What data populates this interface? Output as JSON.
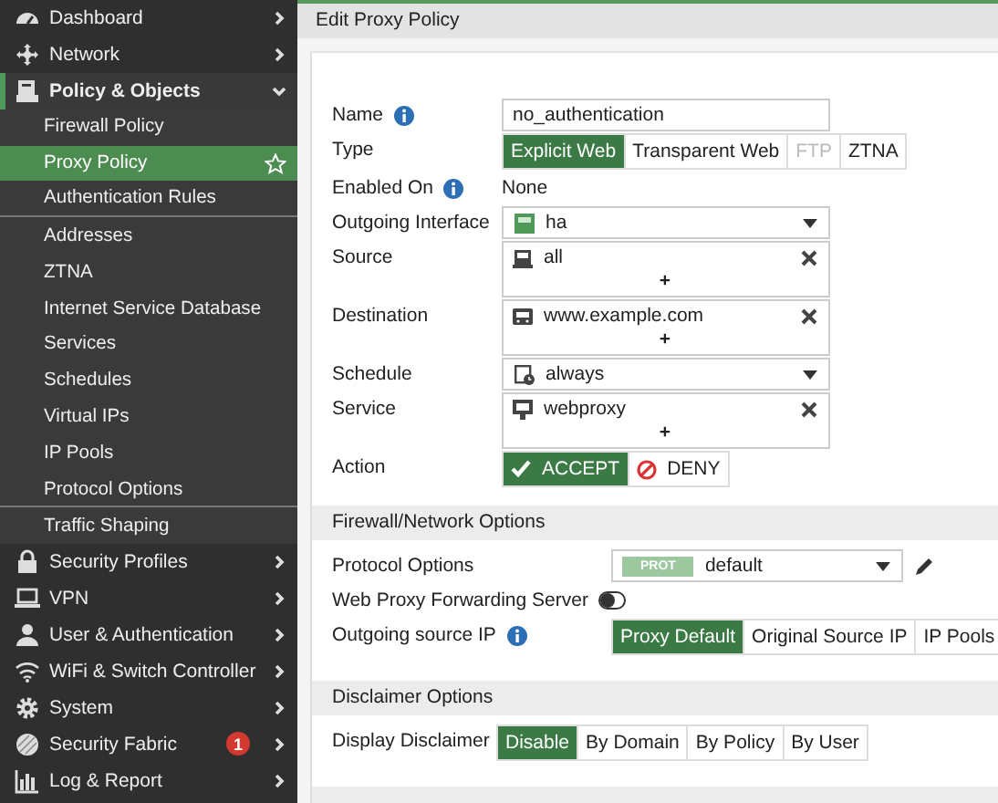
{
  "sidebar": {
    "items": [
      {
        "kind": "top",
        "label": "Dashboard",
        "expanded": false,
        "selected": false
      },
      {
        "kind": "top",
        "label": "Network",
        "expanded": false,
        "selected": false
      },
      {
        "kind": "top",
        "label": "Policy & Objects",
        "expanded": true,
        "selected": false
      },
      {
        "kind": "sub",
        "label": "Firewall Policy",
        "selected": false,
        "separator": false
      },
      {
        "kind": "sub",
        "label": "Proxy Policy",
        "selected": true,
        "separator": false,
        "favorite": true
      },
      {
        "kind": "sub",
        "label": "Authentication Rules",
        "selected": false,
        "separator": true
      },
      {
        "kind": "sub",
        "label": "Addresses",
        "selected": false,
        "separator": false
      },
      {
        "kind": "sub",
        "label": "ZTNA",
        "selected": false,
        "separator": false
      },
      {
        "kind": "sub",
        "label": "Internet Service Database",
        "selected": false,
        "separator": false
      },
      {
        "kind": "sub",
        "label": "Services",
        "selected": false,
        "separator": false
      },
      {
        "kind": "sub",
        "label": "Schedules",
        "selected": false,
        "separator": false
      },
      {
        "kind": "sub",
        "label": "Virtual IPs",
        "selected": false,
        "separator": false
      },
      {
        "kind": "sub",
        "label": "IP Pools",
        "selected": false,
        "separator": false
      },
      {
        "kind": "sub",
        "label": "Protocol Options",
        "selected": false,
        "separator": true
      },
      {
        "kind": "sub",
        "label": "Traffic Shaping",
        "selected": false,
        "separator": false
      },
      {
        "kind": "top",
        "label": "Security Profiles",
        "expanded": false,
        "selected": false
      },
      {
        "kind": "top",
        "label": "VPN",
        "expanded": false,
        "selected": false
      },
      {
        "kind": "top",
        "label": "User & Authentication",
        "expanded": false,
        "selected": false
      },
      {
        "kind": "top",
        "label": "WiFi & Switch Controller",
        "expanded": false,
        "selected": false
      },
      {
        "kind": "top",
        "label": "System",
        "expanded": false,
        "selected": false
      },
      {
        "kind": "top",
        "label": "Security Fabric",
        "expanded": false,
        "selected": false,
        "badge": "1"
      },
      {
        "kind": "top",
        "label": "Log & Report",
        "expanded": false,
        "selected": false
      }
    ]
  },
  "page": {
    "title": "Edit Proxy Policy",
    "rows": [
      {
        "kind": "text",
        "label": "Name",
        "info": true,
        "value": "no_authentication"
      },
      {
        "kind": "segmented",
        "label": "Type",
        "options": [
          {
            "label": "Explicit Web",
            "selected": true,
            "disabled": false
          },
          {
            "label": "Transparent Web",
            "selected": false,
            "disabled": false
          },
          {
            "label": "FTP",
            "selected": false,
            "disabled": true
          },
          {
            "label": "ZTNA",
            "selected": false,
            "disabled": false
          }
        ]
      },
      {
        "kind": "static",
        "label": "Enabled On",
        "info": true,
        "value": "None"
      },
      {
        "kind": "select",
        "label": "Outgoing Interface",
        "value": "ha"
      },
      {
        "kind": "multi",
        "label": "Source",
        "entries": [
          "all"
        ],
        "add": "+"
      },
      {
        "kind": "multi",
        "label": "Destination",
        "entries": [
          "www.example.com"
        ],
        "add": "+"
      },
      {
        "kind": "select",
        "label": "Schedule",
        "value": "always"
      },
      {
        "kind": "multi",
        "label": "Service",
        "entries": [
          "webproxy"
        ],
        "add": "+"
      },
      {
        "kind": "action",
        "label": "Action",
        "options": [
          {
            "label": "ACCEPT",
            "selected": true
          },
          {
            "label": "DENY",
            "selected": false
          }
        ]
      }
    ],
    "sections": [
      {
        "title": "Firewall/Network Options",
        "rows": [
          {
            "kind": "select",
            "label": "Protocol Options",
            "tag": "PROT",
            "value": "default",
            "editable": true
          },
          {
            "kind": "toggle",
            "label": "Web Proxy Forwarding Server",
            "on": false
          },
          {
            "kind": "segmented",
            "label": "Outgoing source IP",
            "info": true,
            "options": [
              {
                "label": "Proxy Default",
                "selected": true,
                "disabled": false
              },
              {
                "label": "Original Source IP",
                "selected": false,
                "disabled": false
              },
              {
                "label": "IP Pools",
                "selected": false,
                "disabled": false
              }
            ]
          }
        ]
      },
      {
        "title": "Disclaimer Options",
        "rows": [
          {
            "kind": "segmented",
            "label": "Display Disclaimer",
            "options": [
              {
                "label": "Disable",
                "selected": true,
                "disabled": false
              },
              {
                "label": "By Domain",
                "selected": false,
                "disabled": false
              },
              {
                "label": "By Policy",
                "selected": false,
                "disabled": false
              },
              {
                "label": "By User",
                "selected": false,
                "disabled": false
              }
            ]
          }
        ]
      }
    ]
  }
}
